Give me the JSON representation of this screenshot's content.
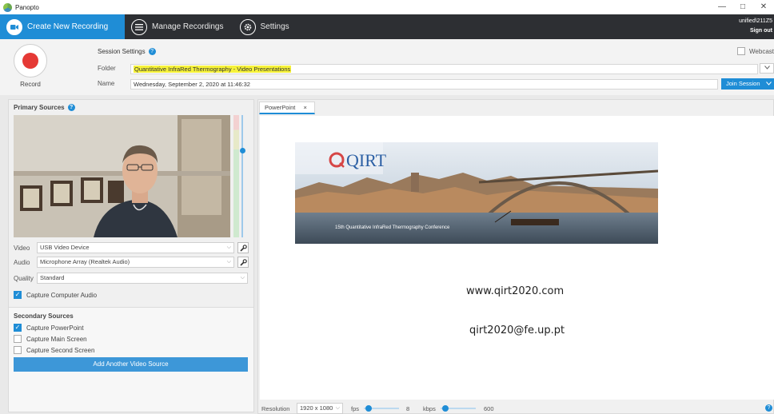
{
  "window": {
    "title": "Panopto",
    "minimize_glyph": "—",
    "maximize_glyph": "□",
    "close_glyph": "✕"
  },
  "nav": {
    "tabs": [
      {
        "label": "Create New Recording",
        "icon": "video-icon",
        "active": true
      },
      {
        "label": "Manage Recordings",
        "icon": "list-icon",
        "active": false
      },
      {
        "label": "Settings",
        "icon": "gear-icon",
        "active": false
      }
    ],
    "user": "unified\\211Z5",
    "signout": "Sign out"
  },
  "record": {
    "label": "Record"
  },
  "session": {
    "title": "Session Settings",
    "folder_label": "Folder",
    "folder_value": "Quantitative InfraRed Thermography - Video Presentations",
    "name_label": "Name",
    "name_value": "Wednesday, September 2, 2020 at 11:46:32",
    "webcast_label": "Webcast",
    "join_session": "Join Session"
  },
  "primary": {
    "title": "Primary Sources",
    "video_label": "Video",
    "video_value": "USB Video Device",
    "audio_label": "Audio",
    "audio_value": "Microphone Array (Realtek Audio)",
    "quality_label": "Quality",
    "quality_value": "Standard",
    "capture_audio": "Capture Computer Audio"
  },
  "secondary": {
    "title": "Secondary Sources",
    "items": [
      {
        "label": "Capture PowerPoint",
        "checked": true
      },
      {
        "label": "Capture Main Screen",
        "checked": false
      },
      {
        "label": "Capture Second Screen",
        "checked": false
      }
    ],
    "add_button": "Add Another Video Source"
  },
  "preview": {
    "tab_label": "PowerPoint",
    "tab_close": "×",
    "logo_text": "QIRT",
    "banner_caption": "15th Quantitative InfraRed Thermography Conference",
    "url": "www.qirt2020.com",
    "email": "qirt2020@fe.up.pt"
  },
  "status": {
    "resolution_label": "Resolution",
    "resolution_value": "1920 x 1080",
    "fps_label": "fps",
    "fps_value": "8",
    "kbps_label": "kbps",
    "kbps_value": "600"
  },
  "colors": {
    "accent": "#1f8dd6",
    "nav_bg": "#2d2f33",
    "record_red": "#e53935",
    "highlight": "#f6f23a"
  }
}
